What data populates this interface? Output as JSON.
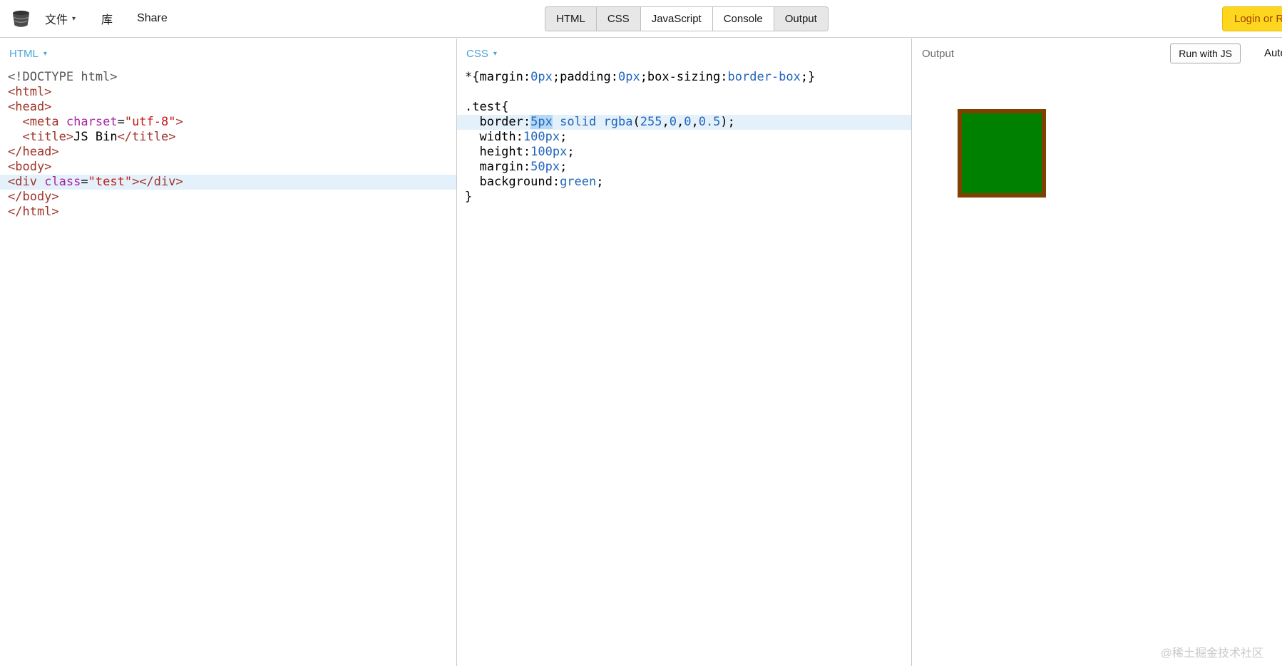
{
  "topbar": {
    "menu": {
      "file": "文件",
      "file_caret": "▾",
      "library": "库",
      "share": "Share"
    },
    "tabs": [
      {
        "label": "HTML",
        "active": true
      },
      {
        "label": "CSS",
        "active": true
      },
      {
        "label": "JavaScript",
        "active": false
      },
      {
        "label": "Console",
        "active": false
      },
      {
        "label": "Output",
        "active": true
      }
    ],
    "login_label": "Login or R"
  },
  "html_panel": {
    "title": "HTML",
    "caret": "▾",
    "lines": [
      {
        "t": [
          [
            "meta",
            "<!DOCTYPE html>"
          ]
        ]
      },
      {
        "t": [
          [
            "tag",
            "<html>"
          ]
        ]
      },
      {
        "t": [
          [
            "tag",
            "<head>"
          ]
        ]
      },
      {
        "t": [
          [
            "plain",
            "  "
          ],
          [
            "tag",
            "<meta"
          ],
          [
            "plain",
            " "
          ],
          [
            "attr",
            "charset"
          ],
          [
            "plain",
            "="
          ],
          [
            "str",
            "\"utf-8\""
          ],
          [
            "tag",
            ">"
          ]
        ]
      },
      {
        "t": [
          [
            "plain",
            "  "
          ],
          [
            "tag",
            "<title>"
          ],
          [
            "plain",
            "JS Bin"
          ],
          [
            "tag",
            "</title>"
          ]
        ]
      },
      {
        "t": [
          [
            "tag",
            "</head>"
          ]
        ]
      },
      {
        "t": [
          [
            "tag",
            "<body>"
          ]
        ]
      },
      {
        "a": true,
        "t": [
          [
            "tag",
            "<div"
          ],
          [
            "plain",
            " "
          ],
          [
            "attr",
            "class"
          ],
          [
            "plain",
            "="
          ],
          [
            "str",
            "\"test\""
          ],
          [
            "tag",
            "></div>"
          ]
        ]
      },
      {
        "t": [
          [
            "tag",
            "</body>"
          ]
        ]
      },
      {
        "t": [
          [
            "tag",
            "</html>"
          ]
        ]
      }
    ]
  },
  "css_panel": {
    "title": "CSS",
    "caret": "▾",
    "lines": [
      {
        "t": [
          [
            "plain",
            "*{margin:"
          ],
          [
            "val",
            "0px"
          ],
          [
            "plain",
            ";padding:"
          ],
          [
            "val",
            "0px"
          ],
          [
            "plain",
            ";box-sizing:"
          ],
          [
            "val",
            "border-box"
          ],
          [
            "plain",
            ";}"
          ]
        ]
      },
      {
        "t": []
      },
      {
        "t": [
          [
            "plain",
            ".test{"
          ]
        ]
      },
      {
        "a": true,
        "t": [
          [
            "plain",
            "  border:"
          ],
          [
            "val sel",
            "5px"
          ],
          [
            "plain",
            " "
          ],
          [
            "val",
            "solid"
          ],
          [
            "plain",
            " "
          ],
          [
            "val",
            "rgba"
          ],
          [
            "plain",
            "("
          ],
          [
            "val",
            "255"
          ],
          [
            "plain",
            ","
          ],
          [
            "val",
            "0"
          ],
          [
            "plain",
            ","
          ],
          [
            "val",
            "0"
          ],
          [
            "plain",
            ","
          ],
          [
            "val",
            "0.5"
          ],
          [
            "plain",
            ");"
          ]
        ]
      },
      {
        "t": [
          [
            "plain",
            "  width:"
          ],
          [
            "val",
            "100px"
          ],
          [
            "plain",
            ";"
          ]
        ]
      },
      {
        "t": [
          [
            "plain",
            "  height:"
          ],
          [
            "val",
            "100px"
          ],
          [
            "plain",
            ";"
          ]
        ]
      },
      {
        "t": [
          [
            "plain",
            "  margin:"
          ],
          [
            "val",
            "50px"
          ],
          [
            "plain",
            ";"
          ]
        ]
      },
      {
        "t": [
          [
            "plain",
            "  background:"
          ],
          [
            "val",
            "green"
          ],
          [
            "plain",
            ";"
          ]
        ]
      },
      {
        "t": [
          [
            "plain",
            "}"
          ]
        ]
      }
    ]
  },
  "output_panel": {
    "title": "Output",
    "run_button": "Run with JS",
    "auto_label": "Auto",
    "box": {
      "fill": "#008000",
      "border_color": "#7f4000"
    }
  },
  "watermark": "@稀土掘金技术社区",
  "colors": {
    "header_label_blue": "#49a4da",
    "active_line_bg": "#e4f1fb",
    "selection_bg": "#b5d8f5",
    "login_button_bg": "#ffd61e",
    "token_tag": "#a0342a",
    "token_attribute": "#a626a4",
    "token_string": "#c41a16",
    "token_value": "#2266bb"
  }
}
